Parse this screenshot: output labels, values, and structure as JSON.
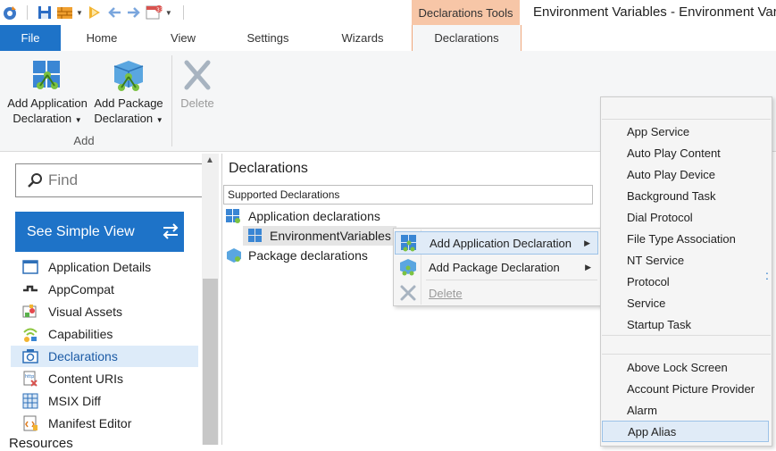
{
  "window": {
    "title": "Environment Variables - Environment Vari",
    "context_tab_group": "Declarations Tools"
  },
  "ribbon": {
    "tabs": [
      "File",
      "Home",
      "View",
      "Settings",
      "Wizards",
      "Declarations"
    ],
    "active_tab": "Declarations",
    "group_label": "Add",
    "buttons": {
      "add_app_line1": "Add Application",
      "add_app_line2": "Declaration",
      "add_pkg_line1": "Add Package",
      "add_pkg_line2": "Declaration",
      "delete": "Delete"
    }
  },
  "sidebar": {
    "search_placeholder": "Find",
    "simple_view_button": "See Simple View",
    "items": [
      {
        "label": "Application Details",
        "icon": "window-icon"
      },
      {
        "label": "AppCompat",
        "icon": "shim-icon"
      },
      {
        "label": "Visual Assets",
        "icon": "image-icon"
      },
      {
        "label": "Capabilities",
        "icon": "capabilities-icon"
      },
      {
        "label": "Declarations",
        "icon": "declarations-icon"
      },
      {
        "label": "Content URIs",
        "icon": "content-uri-icon"
      },
      {
        "label": "MSIX Diff",
        "icon": "diff-grid-icon"
      },
      {
        "label": "Manifest Editor",
        "icon": "xml-editor-icon"
      }
    ],
    "selected": "Declarations",
    "next_section": "Resources"
  },
  "main": {
    "title": "Declarations",
    "column_header": "Supported Declarations",
    "tree": {
      "app_declarations": "Application declarations",
      "env_var": "EnvironmentVariables",
      "pkg_declarations": "Package declarations"
    }
  },
  "context_menu": {
    "items": [
      {
        "label": "Add Application Declaration",
        "submenu": true,
        "highlighted": true
      },
      {
        "label": "Add Package Declaration",
        "submenu": true
      },
      {
        "label": "Delete",
        "disabled": true
      }
    ]
  },
  "submenu": {
    "group1": [
      "App Service",
      "Auto Play Content",
      "Auto Play Device",
      "Background Task",
      "Dial Protocol",
      "File Type Association",
      "NT Service",
      "Protocol",
      "Service",
      "Startup Task"
    ],
    "group2": [
      "Above Lock Screen",
      "Account Picture Provider",
      "Alarm",
      "App Alias"
    ],
    "highlighted": "App Alias"
  },
  "colors": {
    "accent": "#1e73c8",
    "context_tab": "#f7c6a7",
    "selection": "#ddebf9"
  }
}
